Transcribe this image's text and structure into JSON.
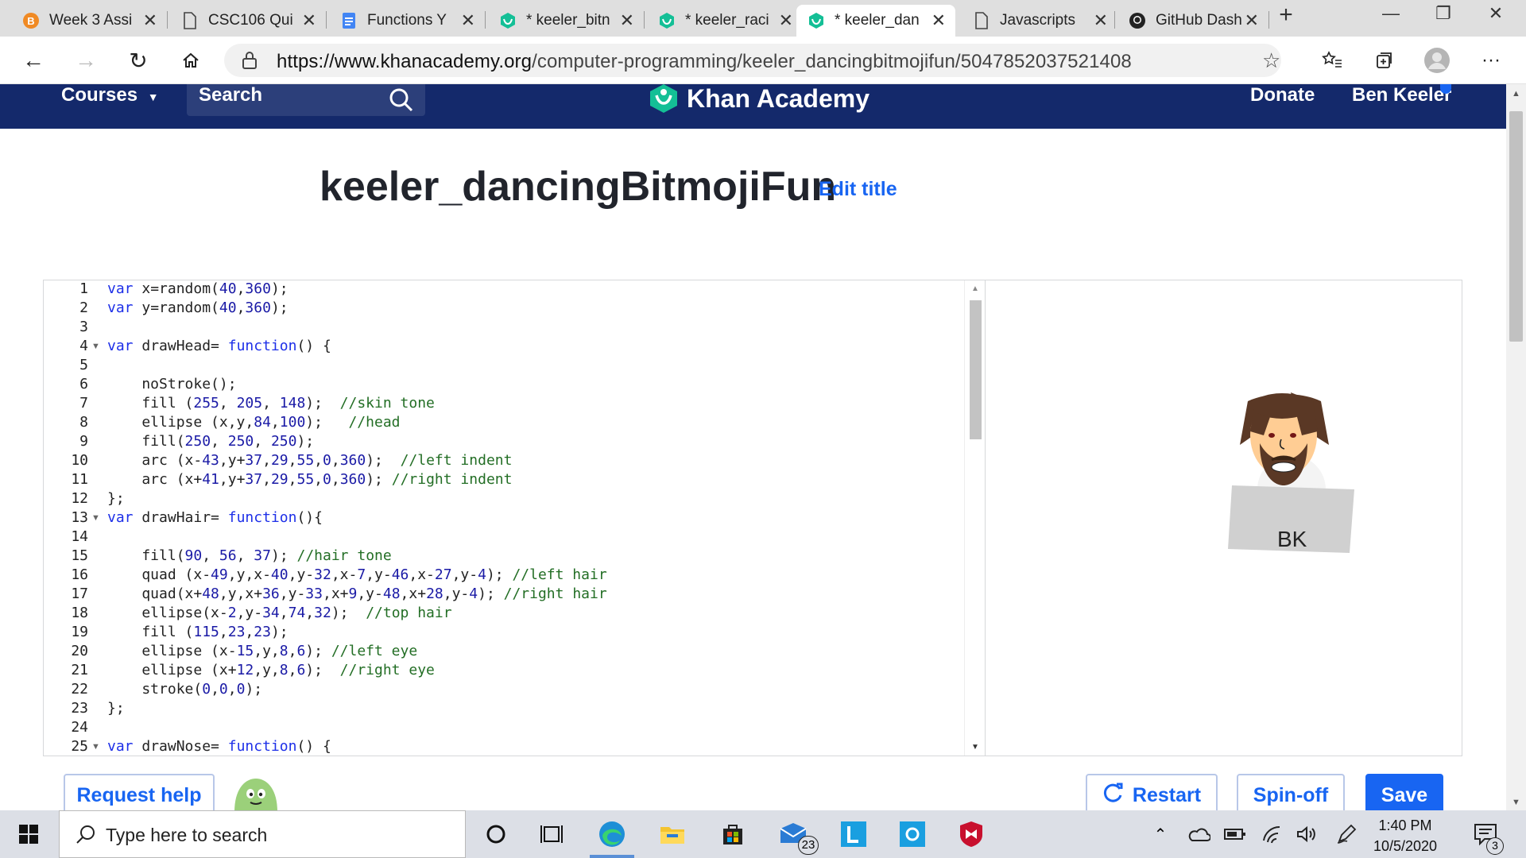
{
  "browser": {
    "tabs": [
      {
        "label": "Week 3 Assi",
        "icon": "brightspace-icon"
      },
      {
        "label": "CSC106 Qui",
        "icon": "page-icon"
      },
      {
        "label": "Functions Y",
        "icon": "docs-icon"
      },
      {
        "label": "* keeler_bitn",
        "icon": "khan-icon"
      },
      {
        "label": "* keeler_raci",
        "icon": "khan-icon"
      },
      {
        "label": "* keeler_dan",
        "icon": "khan-icon"
      },
      {
        "label": "Javascripts",
        "icon": "page-icon"
      },
      {
        "label": "GitHub Dash",
        "icon": "github-icon"
      }
    ],
    "url_host": "https://www.khanacademy.org",
    "url_path": "/computer-programming/keeler_dancingbitmojifun/5047852037521408"
  },
  "header": {
    "courses": "Courses",
    "search": "Search",
    "logo": "Khan Academy",
    "donate": "Donate",
    "user": "Ben Keeler"
  },
  "page": {
    "title": "keeler_dancingBitmojiFun",
    "edit_title": "Edit title"
  },
  "code_lines": [
    "var x=random(40,360);",
    "var y=random(40,360);",
    "",
    "var drawHead= function() {",
    "",
    "    noStroke();",
    "    fill (255, 205, 148);  //skin tone",
    "    ellipse (x,y,84,100);   //head",
    "    fill(250, 250, 250);",
    "    arc (x-43,y+37,29,55,0,360);  //left indent",
    "    arc (x+41,y+37,29,55,0,360); //right indent",
    "};",
    "var drawHair= function(){",
    "",
    "    fill(90, 56, 37); //hair tone",
    "    quad (x-49,y,x-40,y-32,x-7,y-46,x-27,y-4); //left hair",
    "    quad(x+48,y,x+36,y-33,x+9,y-48,x+28,y-4); //right hair",
    "    ellipse(x-2,y-34,74,32);  //top hair",
    "    fill (115,23,23);",
    "    ellipse (x-15,y,8,6); //left eye",
    "    ellipse (x+12,y,8,6);  //right eye",
    "    stroke(0,0,0);",
    "};",
    "",
    "var drawNose= function() {"
  ],
  "canvas": {
    "initials": "BK"
  },
  "buttons": {
    "request_help": "Request help",
    "restart": "Restart",
    "spin_off": "Spin-off",
    "save": "Save"
  },
  "taskbar": {
    "search_placeholder": "Type here to search",
    "mail_badge": "23",
    "time": "1:40 PM",
    "date": "10/5/2020",
    "notification_count": "3"
  },
  "colors": {
    "header_bg": "#14296b",
    "accent": "#1865f2",
    "khan_green": "#14bf96"
  }
}
